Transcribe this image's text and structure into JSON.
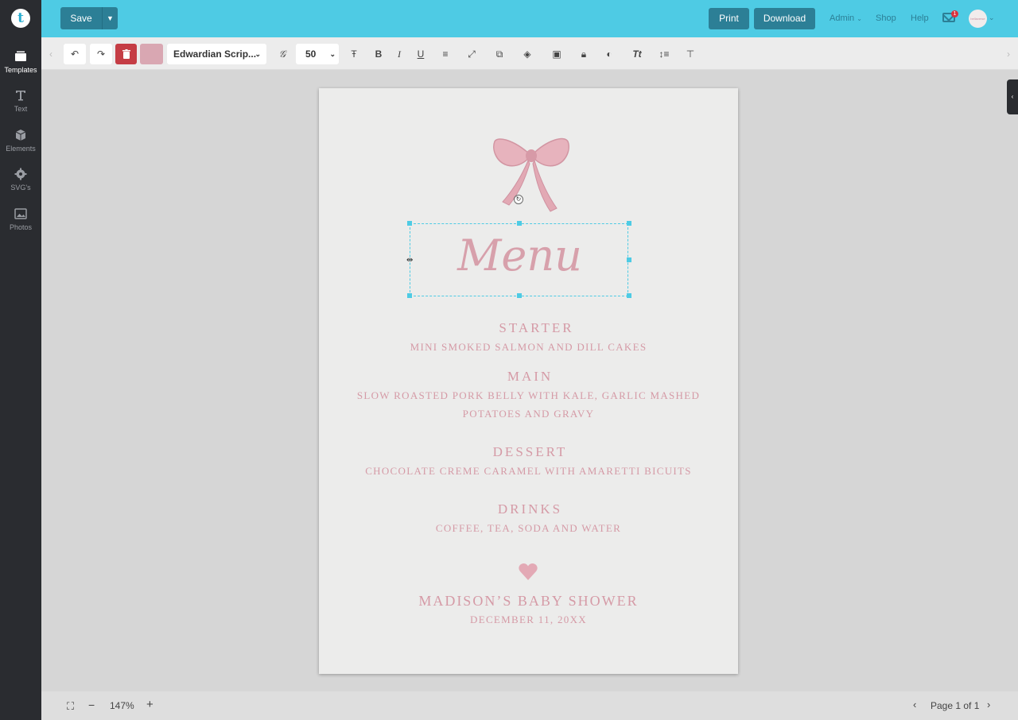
{
  "topbar": {
    "save_label": "Save",
    "print_label": "Print",
    "download_label": "Download",
    "admin_label": "Admin",
    "shop_label": "Shop",
    "help_label": "Help",
    "mail_badge_count": "1",
    "avatar_text": "bellaverse"
  },
  "sidebar": {
    "items": [
      {
        "label": "Templates",
        "icon": "templates-icon"
      },
      {
        "label": "Text",
        "icon": "text-icon"
      },
      {
        "label": "Elements",
        "icon": "cube-icon"
      },
      {
        "label": "SVG's",
        "icon": "gear-icon"
      },
      {
        "label": "Photos",
        "icon": "photo-icon"
      }
    ]
  },
  "toolbar": {
    "font_name": "Edwardian Scrip...",
    "font_size": "50",
    "color_swatch": "#d9a7b2",
    "bold_label": "B",
    "italic_label": "I",
    "underline_label": "U",
    "tt_label": "Tt"
  },
  "document": {
    "title": "Menu",
    "sections": [
      {
        "heading": "STARTER",
        "lines": [
          "MINI SMOKED SALMON AND DILL CAKES"
        ]
      },
      {
        "heading": "MAIN",
        "lines": [
          "SLOW ROASTED PORK BELLY WITH KALE, GARLIC MASHED",
          "POTATOES AND GRAVY"
        ]
      },
      {
        "heading": "DESSERT",
        "lines": [
          "CHOCOLATE CREME CARAMEL WITH AMARETTI BICUITS"
        ]
      },
      {
        "heading": "DRINKS",
        "lines": [
          "COFFEE, TEA, SODA AND WATER"
        ]
      }
    ],
    "event_name": "MADISON’S BABY SHOWER",
    "event_date": "DECEMBER 11, 20XX",
    "accent_color": "#d59aa6"
  },
  "bottombar": {
    "zoom": "147%",
    "page_indicator": "Page 1 of 1"
  }
}
